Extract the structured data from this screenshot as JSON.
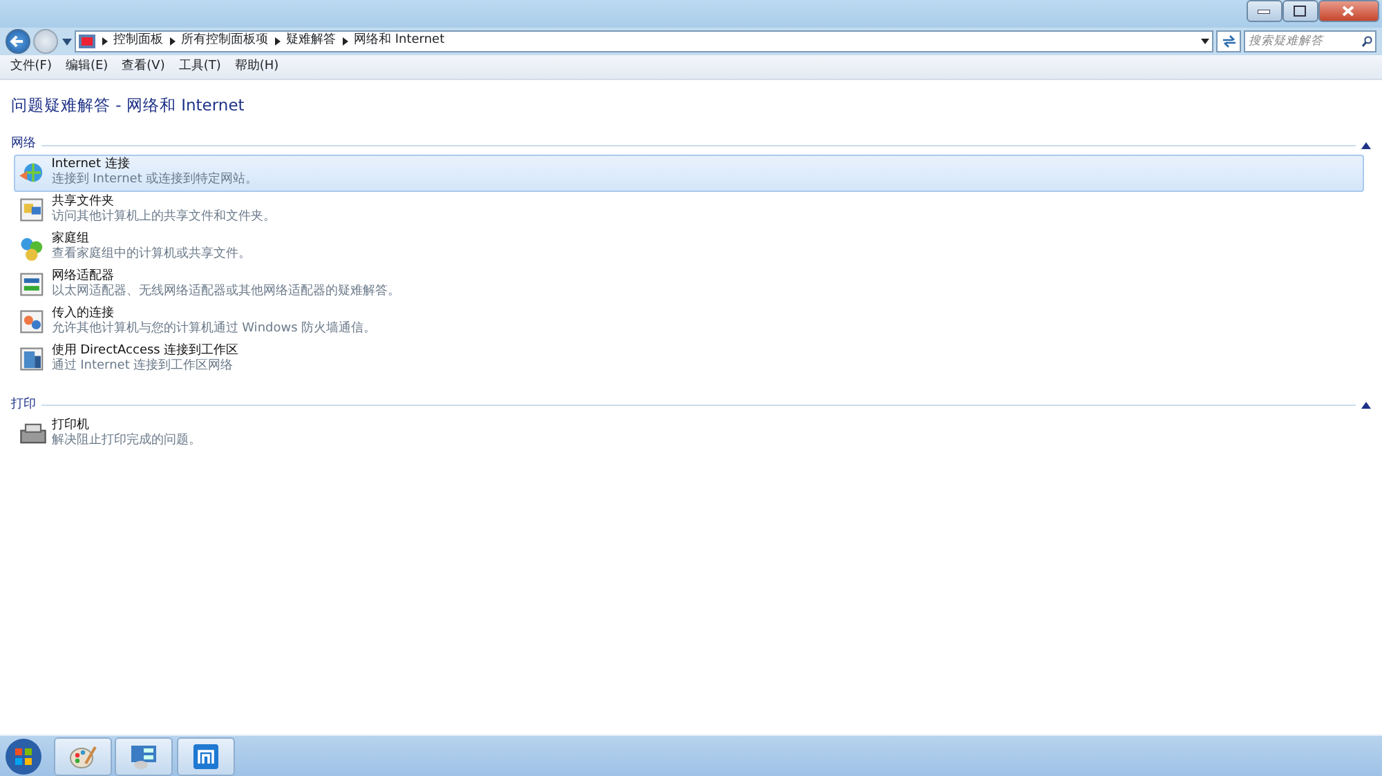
{
  "address_bar": {
    "breadcrumbs": [
      "控制面板",
      "所有控制面板项",
      "疑难解答",
      "网络和 Internet"
    ]
  },
  "search": {
    "placeholder": "搜索疑难解答"
  },
  "menu": [
    "文件(F)",
    "编辑(E)",
    "查看(V)",
    "工具(T)",
    "帮助(H)"
  ],
  "page_title": "问题疑难解答 - 网络和 Internet",
  "sections": [
    {
      "title": "网络",
      "items": [
        {
          "title": "Internet 连接",
          "description": "连接到 Internet 或连接到特定网站。",
          "selected": true
        },
        {
          "title": "共享文件夹",
          "description": "访问其他计算机上的共享文件和文件夹。",
          "selected": false
        },
        {
          "title": "家庭组",
          "description": "查看家庭组中的计算机或共享文件。",
          "selected": false
        },
        {
          "title": "网络适配器",
          "description": "以太网适配器、无线网络适配器或其他网络适配器的疑难解答。",
          "selected": false
        },
        {
          "title": "传入的连接",
          "description": "允许其他计算机与您的计算机通过 Windows 防火墙通信。",
          "selected": false
        },
        {
          "title": "使用 DirectAccess 连接到工作区",
          "description": "通过 Internet 连接到工作区网络",
          "selected": false
        }
      ]
    },
    {
      "title": "打印",
      "items": [
        {
          "title": "打印机",
          "description": "解决阻止打印完成的问题。",
          "selected": false
        }
      ]
    }
  ]
}
